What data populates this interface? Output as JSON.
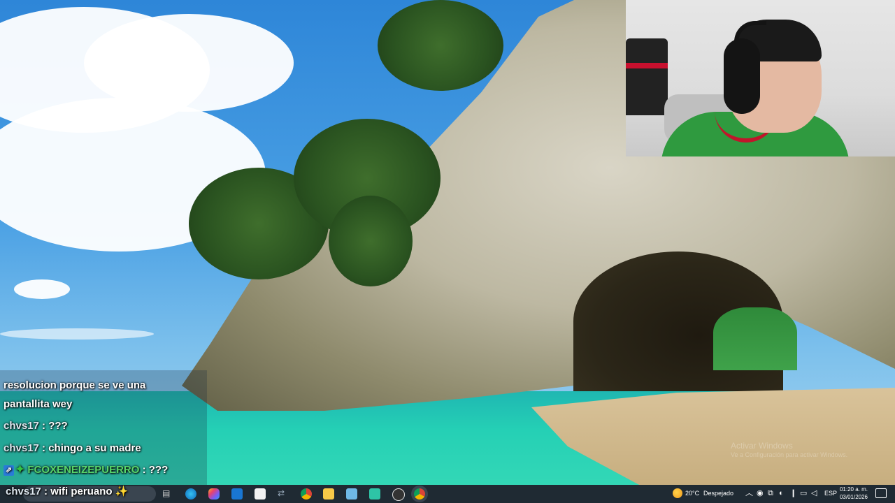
{
  "chat": {
    "messages": [
      {
        "user": "",
        "text": "resolucion porque se ve una"
      },
      {
        "user": "",
        "text": "pantallita wey"
      },
      {
        "user": "chvs17",
        "text": ": ???"
      },
      {
        "user": "chvs17",
        "text": ": chingo a su madre"
      },
      {
        "user": "FCOXENEIZEPUERRO",
        "text": ": ???"
      },
      {
        "user": "chvs17",
        "text": ": wifi peruano"
      }
    ]
  },
  "desktop": {
    "watermark_line1": "Activar Windows",
    "watermark_line2": "Ve a Configuración para activar Windows."
  },
  "taskbar": {
    "weather_temp": "20°C",
    "weather_condition": "Despejado",
    "language": "ESP",
    "time": "01:20 a. m.",
    "date": "03/01/2026",
    "apps": [
      "task-view",
      "edge",
      "copilot",
      "outlook",
      "store",
      "vscode",
      "chrome",
      "file-explorer",
      "notepad",
      "app",
      "obs",
      "chrome-active"
    ]
  },
  "colors": {
    "taskbar_bg": "#1f2a33",
    "chat_green": "#59d66a",
    "webcam_shirt": "#2f9a3f"
  }
}
